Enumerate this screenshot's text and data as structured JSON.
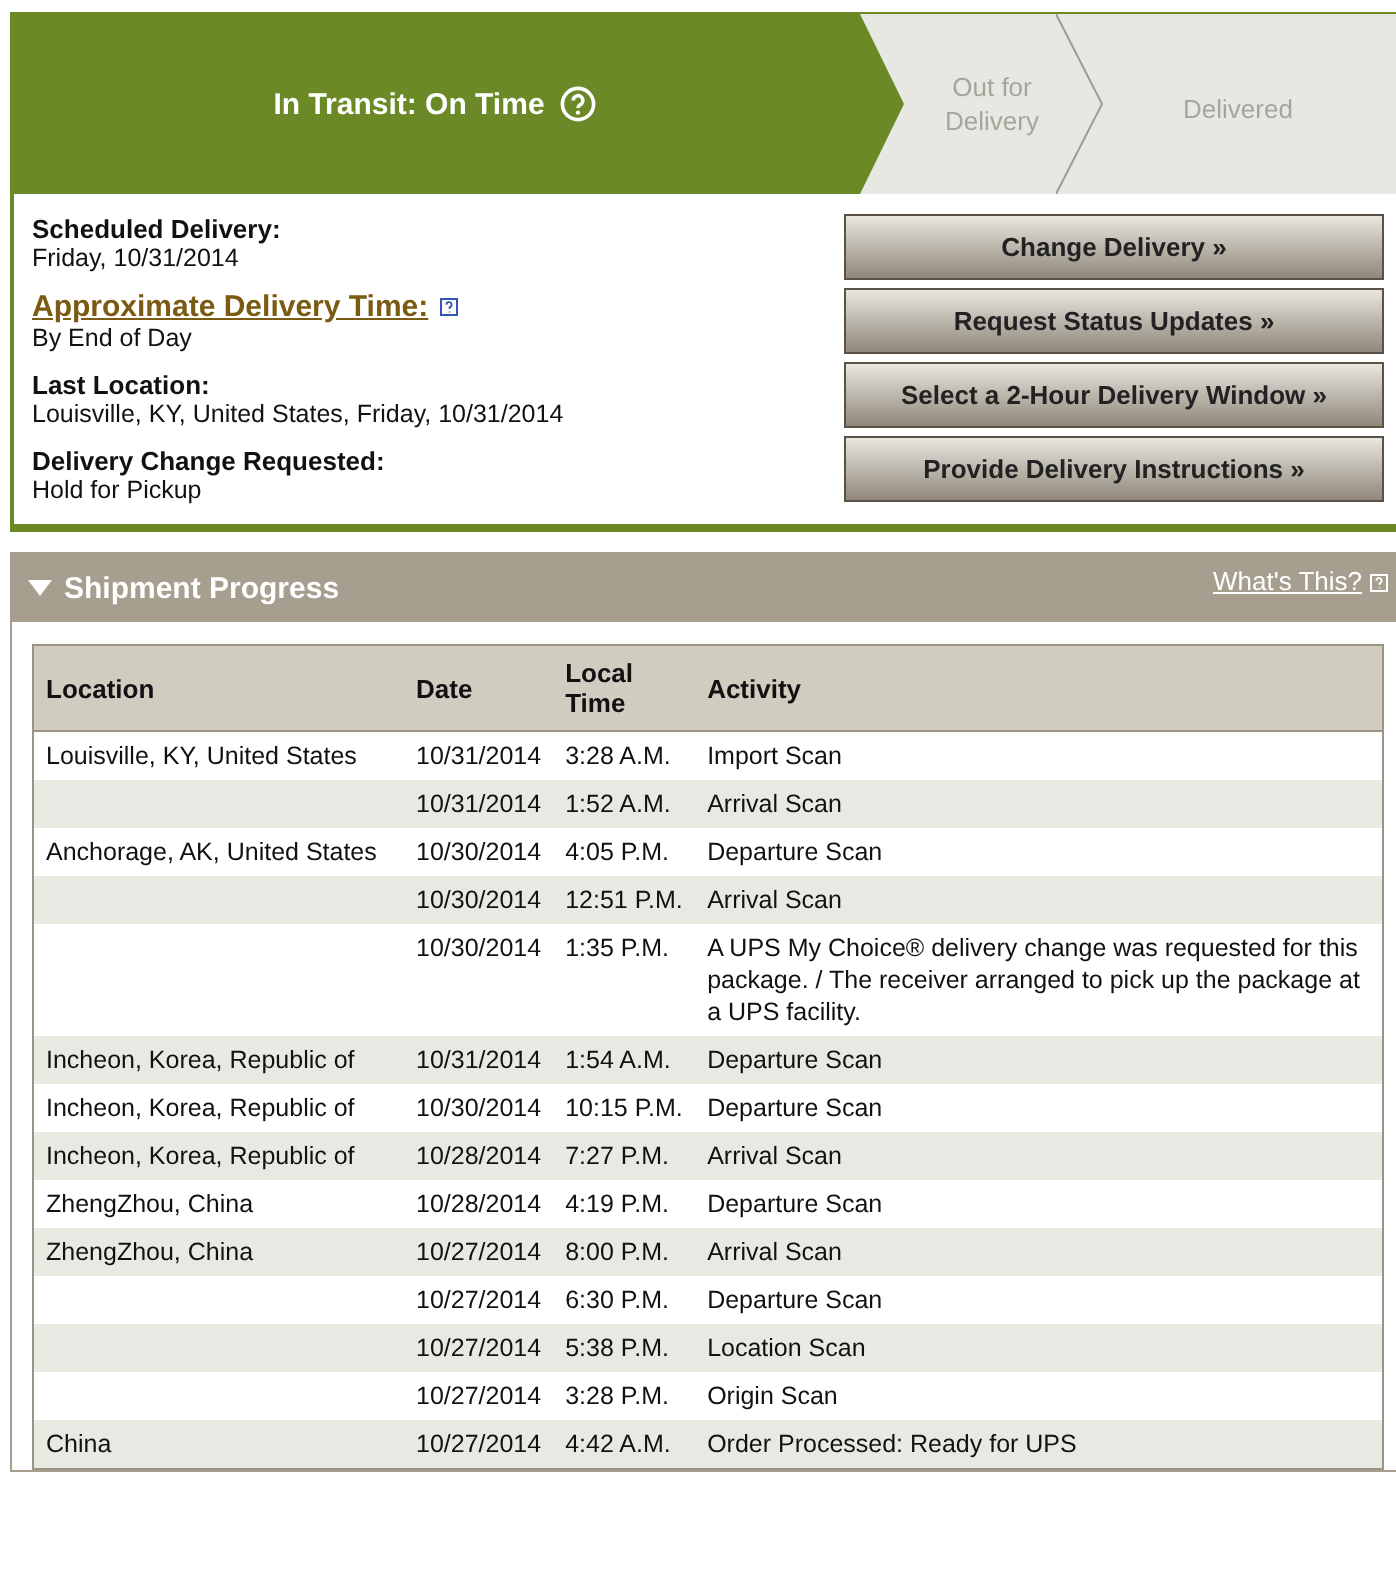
{
  "progress_steps": [
    {
      "label": "In Transit: On Time",
      "selected": true
    },
    {
      "label": "Out for Delivery",
      "selected": false
    },
    {
      "label": "Delivered",
      "selected": false
    }
  ],
  "details": [
    {
      "kind": "plain",
      "label": "Scheduled Delivery:",
      "value": "Friday, 10/31/2014"
    },
    {
      "kind": "link",
      "label": "Approximate Delivery Time:",
      "value": "By End of Day"
    },
    {
      "kind": "plain",
      "label": "Last Location:",
      "value": "Louisville, KY, United States, Friday, 10/31/2014"
    },
    {
      "kind": "plain",
      "label": "Delivery Change Requested:",
      "value": "Hold for Pickup"
    }
  ],
  "actions": [
    "Change Delivery »",
    "Request Status Updates »",
    "Select a 2-Hour Delivery Window »",
    "Provide Delivery Instructions »"
  ],
  "shipment_progress": {
    "title": "Shipment Progress",
    "expanded": true,
    "help_link": "What's This?",
    "columns": [
      "Location",
      "Date",
      "Local Time",
      "Activity"
    ],
    "rows": [
      [
        "Louisville, KY, United States",
        "10/31/2014",
        "3:28 A.M.",
        "Import Scan"
      ],
      [
        "",
        "10/31/2014",
        "1:52 A.M.",
        "Arrival Scan"
      ],
      [
        "Anchorage, AK, United States",
        "10/30/2014",
        "4:05 P.M.",
        "Departure Scan"
      ],
      [
        "",
        "10/30/2014",
        "12:51 P.M.",
        "Arrival Scan"
      ],
      [
        "",
        "10/30/2014",
        "1:35 P.M.",
        "A UPS My Choice® delivery change was requested for this package. / The receiver arranged to pick up the package at a UPS facility."
      ],
      [
        "Incheon, Korea, Republic of",
        "10/31/2014",
        "1:54 A.M.",
        "Departure Scan"
      ],
      [
        "Incheon, Korea, Republic of",
        "10/30/2014",
        "10:15 P.M.",
        "Departure Scan"
      ],
      [
        "Incheon, Korea, Republic of",
        "10/28/2014",
        "7:27 P.M.",
        "Arrival Scan"
      ],
      [
        "ZhengZhou, China",
        "10/28/2014",
        "4:19 P.M.",
        "Departure Scan"
      ],
      [
        "ZhengZhou, China",
        "10/27/2014",
        "8:00 P.M.",
        "Arrival Scan"
      ],
      [
        "",
        "10/27/2014",
        "6:30 P.M.",
        "Departure Scan"
      ],
      [
        "",
        "10/27/2014",
        "5:38 P.M.",
        "Location Scan"
      ],
      [
        "",
        "10/27/2014",
        "3:28 P.M.",
        "Origin Scan"
      ],
      [
        "China",
        "10/27/2014",
        "4:42 A.M.",
        "Order Processed: Ready for UPS"
      ]
    ]
  }
}
